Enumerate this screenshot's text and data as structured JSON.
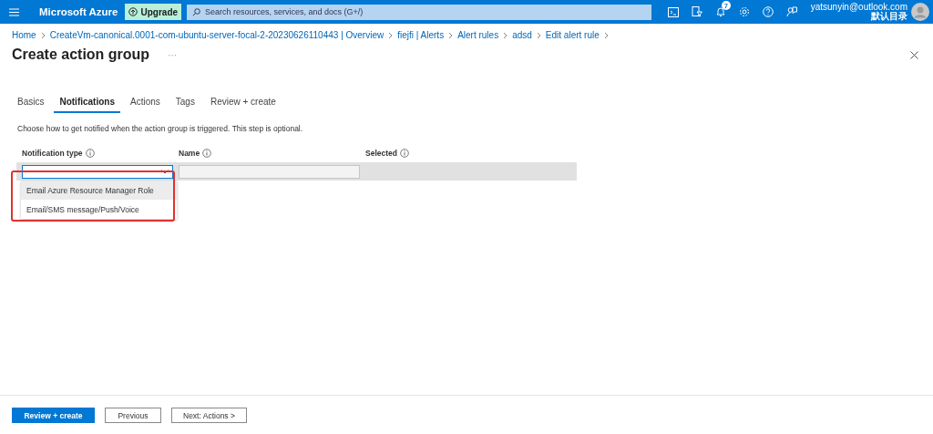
{
  "topbar": {
    "brand": "Microsoft Azure",
    "upgrade": "Upgrade",
    "search": {
      "placeholder": "Search resources, services, and docs (G+/)"
    },
    "notifications_count": "7",
    "user": {
      "email": "yatsunyin@outlook.com",
      "directory": "默认目录"
    }
  },
  "breadcrumbs": [
    "Home",
    "CreateVm-canonical.0001-com-ubuntu-server-focal-2-20230626110443 | Overview",
    "fiejfi | Alerts",
    "Alert rules",
    "adsd",
    "Edit alert rule"
  ],
  "page": {
    "title": "Create action group",
    "more": "···"
  },
  "tabs": [
    {
      "label": "Basics",
      "selected": false
    },
    {
      "label": "Notifications",
      "selected": true
    },
    {
      "label": "Actions",
      "selected": false
    },
    {
      "label": "Tags",
      "selected": false
    },
    {
      "label": "Review + create",
      "selected": false
    }
  ],
  "description": "Choose how to get notified when the action group is triggered. This step is optional.",
  "table": {
    "columns": [
      "Notification type",
      "Name",
      "Selected"
    ]
  },
  "dropdown": {
    "expanded": true,
    "options": [
      {
        "label": "Email Azure Resource Manager Role",
        "highlighted": true
      },
      {
        "label": "Email/SMS message/Push/Voice",
        "highlighted": false
      }
    ]
  },
  "footer": {
    "buttons": [
      {
        "label": "Review + create",
        "kind": "primary"
      },
      {
        "label": "Previous",
        "kind": "secondary"
      },
      {
        "label": "Next: Actions >",
        "kind": "secondary"
      }
    ]
  }
}
